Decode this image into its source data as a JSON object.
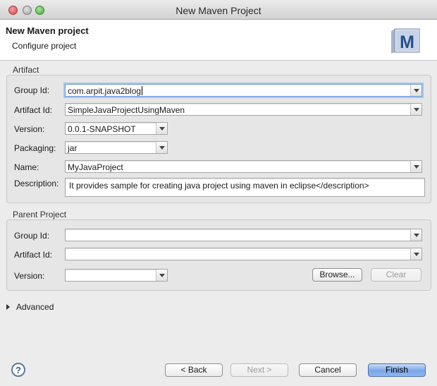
{
  "window": {
    "title": "New Maven Project"
  },
  "header": {
    "title": "New Maven project",
    "subtitle": "Configure project",
    "icon_letter": "M"
  },
  "artifact": {
    "legend": "Artifact",
    "group_id_label": "Group Id:",
    "group_id_value": "com.arpit.java2blog",
    "artifact_id_label": "Artifact Id:",
    "artifact_id_value": "SimpleJavaProjectUsingMaven",
    "version_label": "Version:",
    "version_value": "0.0.1-SNAPSHOT",
    "packaging_label": "Packaging:",
    "packaging_value": "jar",
    "name_label": "Name:",
    "name_value": "MyJavaProject",
    "description_label": "Description:",
    "description_value": "It provides sample for creating java project using maven in eclipse</description>"
  },
  "parent": {
    "legend": "Parent Project",
    "group_id_label": "Group Id:",
    "group_id_value": "",
    "artifact_id_label": "Artifact Id:",
    "artifact_id_value": "",
    "version_label": "Version:",
    "version_value": "",
    "browse_label": "Browse...",
    "clear_label": "Clear"
  },
  "advanced": {
    "label": "Advanced"
  },
  "footer": {
    "help_label": "?",
    "back_label": "< Back",
    "next_label": "Next >",
    "cancel_label": "Cancel",
    "finish_label": "Finish"
  }
}
